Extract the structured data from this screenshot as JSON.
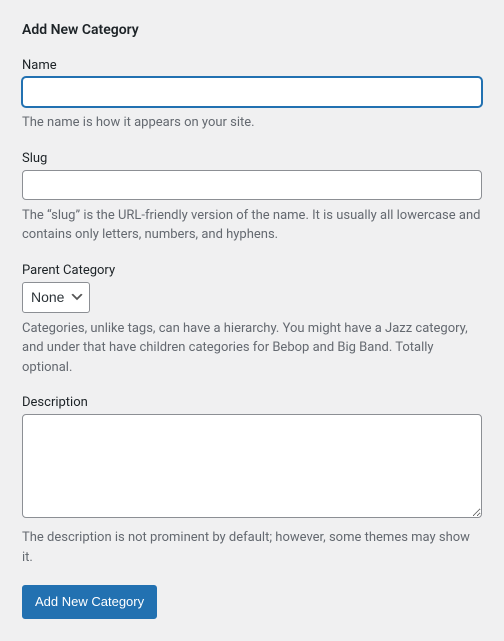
{
  "heading": "Add New Category",
  "fields": {
    "name": {
      "label": "Name",
      "value": "",
      "help": "The name is how it appears on your site."
    },
    "slug": {
      "label": "Slug",
      "value": "",
      "help": "The “slug” is the URL-friendly version of the name. It is usually all lowercase and contains only letters, numbers, and hyphens."
    },
    "parent": {
      "label": "Parent Category",
      "selected": "None",
      "help": "Categories, unlike tags, can have a hierarchy. You might have a Jazz category, and under that have children categories for Bebop and Big Band. Totally optional."
    },
    "description": {
      "label": "Description",
      "value": "",
      "help": "The description is not prominent by default; however, some themes may show it."
    }
  },
  "submit_label": "Add New Category"
}
